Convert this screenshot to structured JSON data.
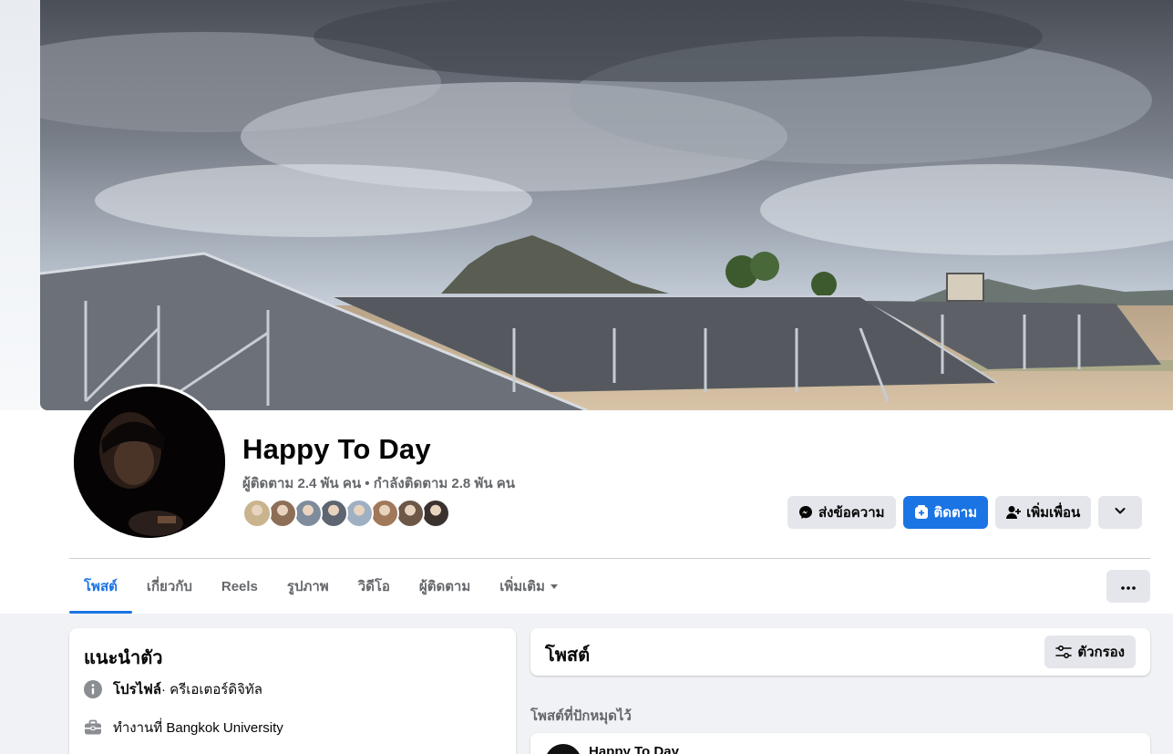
{
  "profile": {
    "name": "Happy To Day",
    "followers_text": "ผู้ติดตาม 2.4 พัน คน • กำลังติดตาม 2.8 พัน คน",
    "friend_avatar_colors": [
      "#c9b48e",
      "#8d6e57",
      "#7f8c9c",
      "#5d6570",
      "#9fb0c3",
      "#a0785a",
      "#6d5848",
      "#3b3230"
    ]
  },
  "actions": {
    "message_label": "ส่งข้อความ",
    "follow_label": "ติดตาม",
    "add_friend_label": "เพิ่มเพื่อน"
  },
  "tabs": [
    {
      "label": "โพสต์",
      "active": true
    },
    {
      "label": "เกี่ยวกับ"
    },
    {
      "label": "Reels"
    },
    {
      "label": "รูปภาพ"
    },
    {
      "label": "วิดีโอ"
    },
    {
      "label": "ผู้ติดตาม"
    },
    {
      "label": "เพิ่มเติม"
    }
  ],
  "intro": {
    "title": "แนะนำตัว",
    "profile_label": "โปรไฟล์",
    "profile_category": " · ครีเอเตอร์ดิจิทัล",
    "work_text": "ทำงานที่ Bangkok University"
  },
  "posts": {
    "title": "โพสต์",
    "filter_label": "ตัวกรอง",
    "pinned_label": "โพสต์ที่ปักหมุดไว้",
    "pinned_author": "Happy To Day"
  },
  "colors": {
    "accent": "#1b74e4",
    "secondary_text": "#65676b",
    "button_bg": "#e4e6eb"
  },
  "icons": {
    "message": "messenger-icon",
    "follow": "follow-icon",
    "add_friend": "add-friend-icon",
    "dropdown": "chevron-down-icon",
    "more": "more-dots-icon",
    "info": "info-icon",
    "work": "briefcase-icon",
    "filter": "filter-icon"
  }
}
